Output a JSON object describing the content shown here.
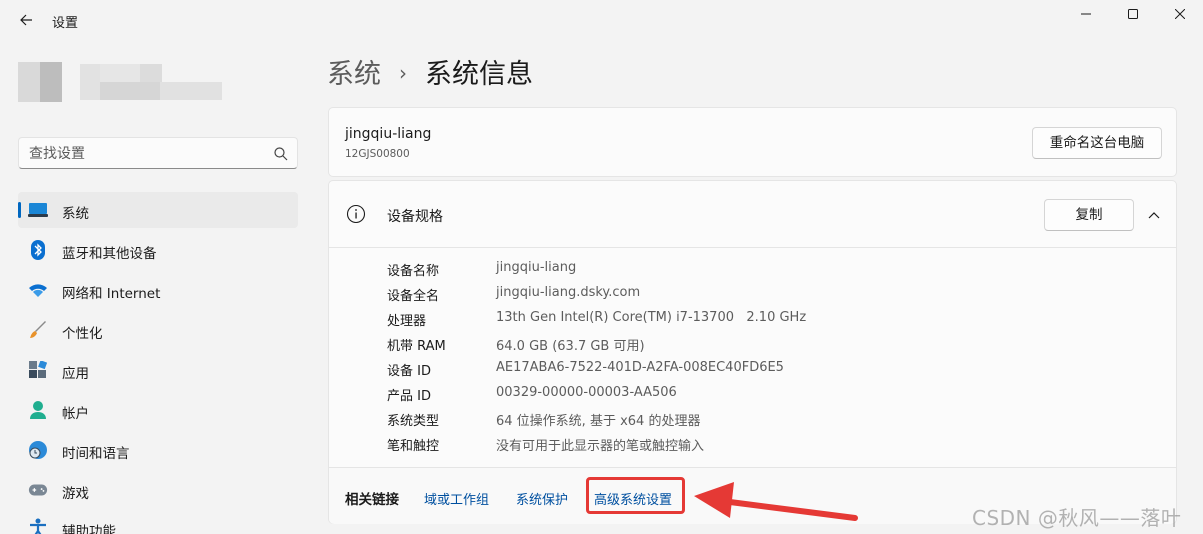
{
  "window": {
    "title": "设置",
    "controls": {
      "minimize_icon": "minimize-icon",
      "maximize_icon": "maximize-icon",
      "close_icon": "close-icon"
    }
  },
  "sidebar": {
    "search": {
      "placeholder": "查找设置",
      "value": ""
    },
    "items": [
      {
        "label": "系统",
        "icon": "laptop-icon",
        "active": true
      },
      {
        "label": "蓝牙和其他设备",
        "icon": "bluetooth-icon"
      },
      {
        "label": "网络和 Internet",
        "icon": "wifi-icon"
      },
      {
        "label": "个性化",
        "icon": "brush-icon"
      },
      {
        "label": "应用",
        "icon": "apps-icon"
      },
      {
        "label": "帐户",
        "icon": "person-icon"
      },
      {
        "label": "时间和语言",
        "icon": "globe-clock-icon"
      },
      {
        "label": "游戏",
        "icon": "gamepad-icon"
      },
      {
        "label": "辅助功能",
        "icon": "accessibility-icon"
      }
    ]
  },
  "main": {
    "breadcrumb": {
      "parent": "系统",
      "separator": "›",
      "current": "系统信息"
    },
    "pc": {
      "name": "jingqiu-liang",
      "model": "12GJS00800",
      "rename_button": "重命名这台电脑"
    },
    "specs": {
      "title": "设备规格",
      "copy_button": "复制",
      "rows": [
        {
          "key": "设备名称",
          "value": "jingqiu-liang"
        },
        {
          "key": "设备全名",
          "value": "jingqiu-liang.dsky.com"
        },
        {
          "key": "处理器",
          "value": "13th Gen Intel(R) Core(TM) i7-13700   2.10 GHz"
        },
        {
          "key": "机带 RAM",
          "value": "64.0 GB (63.7 GB 可用)"
        },
        {
          "key": "设备 ID",
          "value": "AE17ABA6-7522-401D-A2FA-008EC40FD6E5"
        },
        {
          "key": "产品 ID",
          "value": "00329-00000-00003-AA506"
        },
        {
          "key": "系统类型",
          "value": "64 位操作系统, 基于 x64 的处理器"
        },
        {
          "key": "笔和触控",
          "value": "没有可用于此显示器的笔或触控输入"
        }
      ]
    },
    "related_links": {
      "label": "相关链接",
      "links": [
        "域或工作组",
        "系统保护",
        "高级系统设置"
      ]
    }
  },
  "annotation": {
    "highlight_color": "#e53935"
  },
  "watermark": "CSDN @秋风——落叶",
  "colors": {
    "accent": "#0067c0",
    "link": "#0050a0",
    "background": "#f3f3f3",
    "card": "#fbfbfb"
  }
}
